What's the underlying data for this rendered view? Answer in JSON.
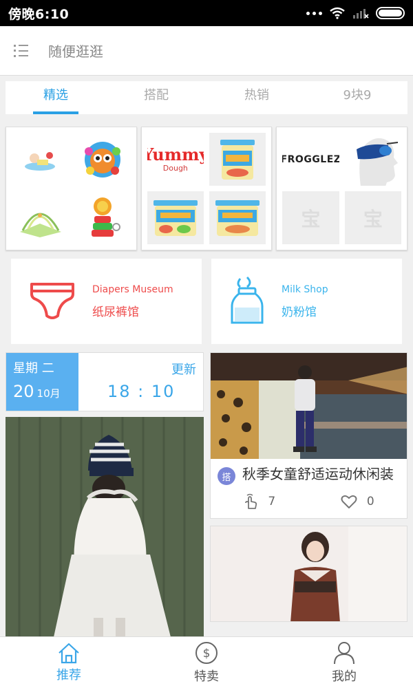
{
  "status_bar": {
    "time": "傍晚6:10"
  },
  "header": {
    "title": "随便逛逛"
  },
  "tabs": [
    {
      "label": "精选",
      "active": true
    },
    {
      "label": "搭配",
      "active": false
    },
    {
      "label": "热销",
      "active": false
    },
    {
      "label": "9块9",
      "active": false
    }
  ],
  "product_cards": [
    {
      "brand": ""
    },
    {
      "brand_line1": "Yummy",
      "brand_line2": "Dough"
    },
    {
      "brand": "FROGGLEZ",
      "placeholder": "宝"
    }
  ],
  "shops": [
    {
      "en": "Diapers Museum",
      "cn": "纸尿裤馆"
    },
    {
      "en": "Milk Shop",
      "cn": "奶粉馆"
    }
  ],
  "date_card": {
    "weekday": "星期 二",
    "day": "20",
    "month": "10月",
    "refresh_label": "更新",
    "time": "18 : 10"
  },
  "post": {
    "tag": "搭",
    "title": "秋季女童舒适运动休闲装",
    "likes": "7",
    "favorites": "0"
  },
  "bottom_nav": [
    {
      "label": "推荐",
      "active": true
    },
    {
      "label": "特卖",
      "active": false
    },
    {
      "label": "我的",
      "active": false
    }
  ],
  "colors": {
    "accent": "#2aa0e4",
    "date_block": "#5ab0f0",
    "diapers": "#ee4b4b",
    "milk": "#3ab4ec",
    "tag": "#7a86d8"
  }
}
